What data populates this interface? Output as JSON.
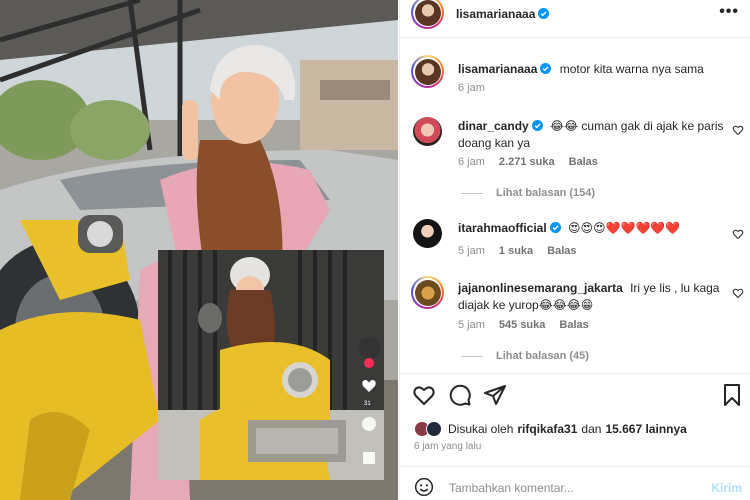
{
  "post": {
    "author": "lisamarianaaa",
    "more_label": "•••",
    "caption": {
      "username": "lisamarianaaa",
      "text": "motor kita warna nya sama",
      "time": "6 jam"
    }
  },
  "comments": [
    {
      "username": "dinar_candy",
      "verified": true,
      "text": "😂😂 cuman gak di ajak ke paris doang kan ya",
      "time": "6 jam",
      "likes": "2.271 suka",
      "reply": "Balas",
      "view_replies": "Lihat balasan (154)"
    },
    {
      "username": "itarahmaofficial",
      "verified": true,
      "text": "😍😍😍❤️❤️❤️❤️❤️",
      "time": "5 jam",
      "likes": "1 suka",
      "reply": "Balas"
    },
    {
      "username": "jajanonlinesemarang_jakarta",
      "verified": false,
      "text": "Iri ye lis , lu kaga diajak ke yurop😂😂😂😁",
      "time": "5 jam",
      "likes": "545 suka",
      "reply": "Balas",
      "view_replies": "Lihat balasan (45)"
    }
  ],
  "likes_line": {
    "prefix": "Disukai oleh",
    "user": "rifqikafa31",
    "and": "dan",
    "others": "15.667 lainnya"
  },
  "post_time": "6 jam yang lalu",
  "add_comment": {
    "placeholder": "Tambahkan komentar...",
    "post_label": "Kirim"
  },
  "colors": {
    "accent": "#0095f6",
    "verified": "#0095f6",
    "heart_red": "#ed4956",
    "scooter_yellow": "#e9c02a",
    "muted": "#8e8e8e"
  }
}
